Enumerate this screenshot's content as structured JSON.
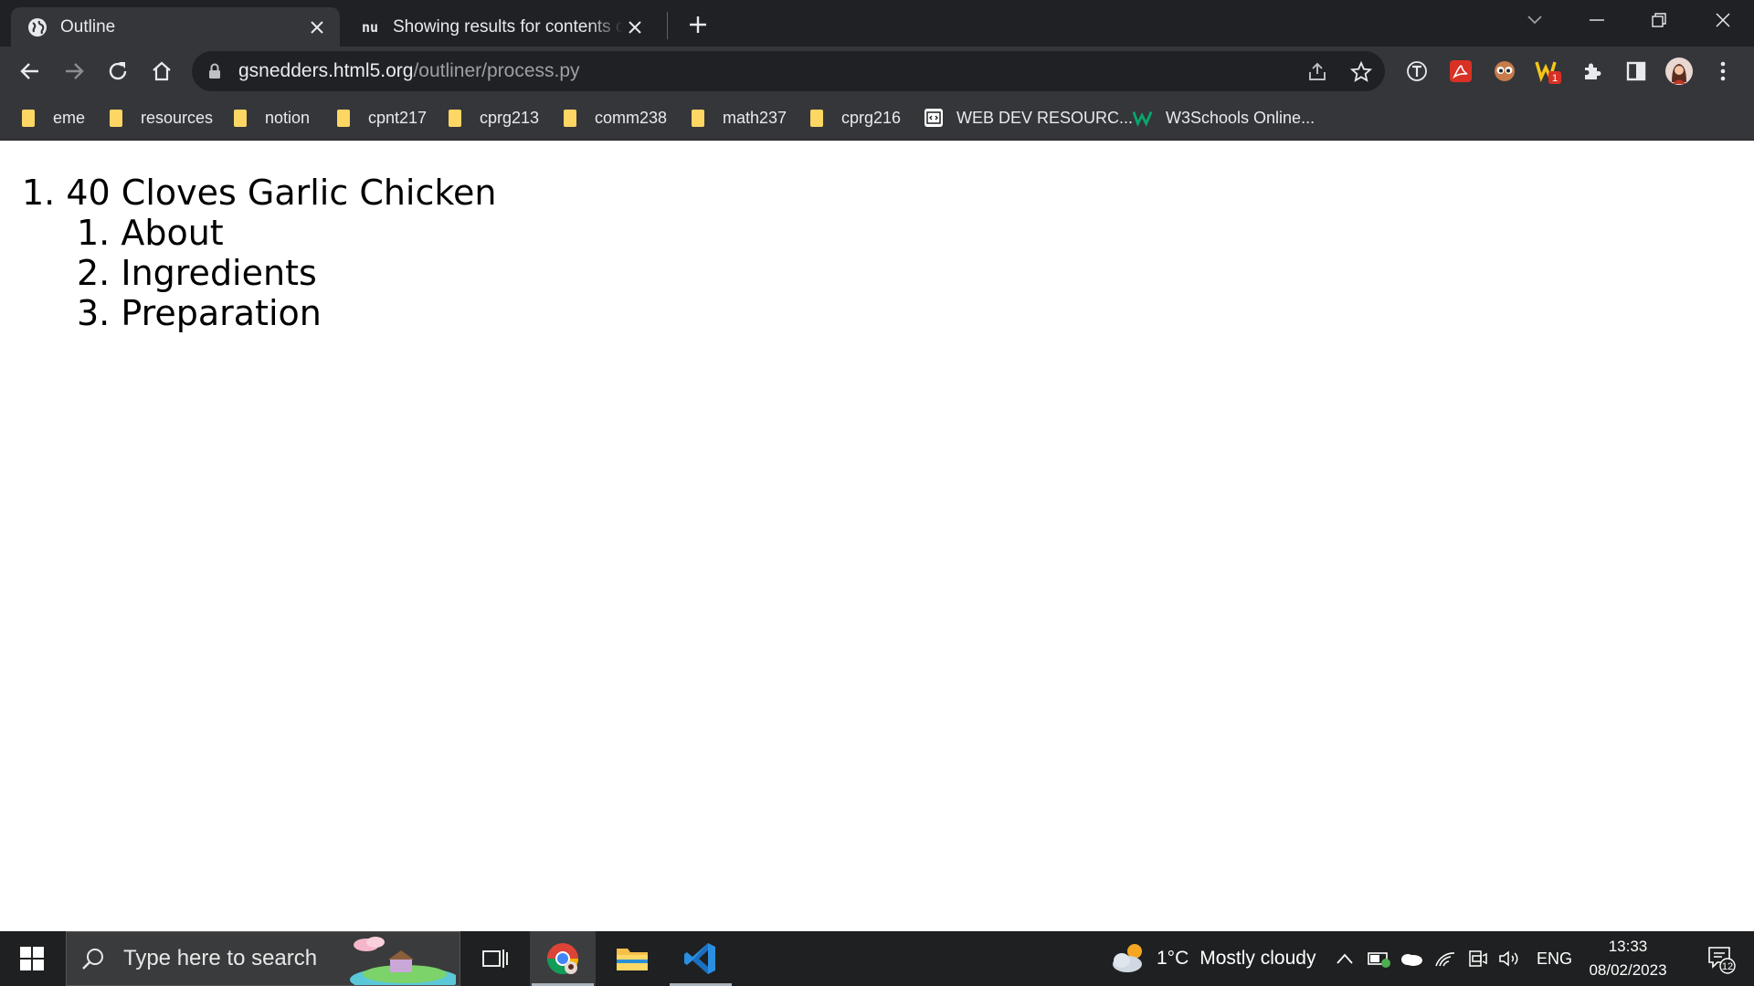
{
  "browser": {
    "tabs": [
      {
        "title": "Outline",
        "favicon": "globe-icon",
        "active": true
      },
      {
        "title": "Showing results for contents of text",
        "favicon": "nu-icon",
        "favicon_text": "nu",
        "active": false
      }
    ],
    "address": {
      "host": "gsnedders.html5.org",
      "path": "/outliner/process.py"
    },
    "bookmarks": [
      {
        "label": "eme",
        "icon": "folder-icon"
      },
      {
        "label": "resources",
        "icon": "folder-icon"
      },
      {
        "label": "notion",
        "icon": "folder-icon"
      },
      {
        "label": "cpnt217",
        "icon": "folder-icon"
      },
      {
        "label": "cprg213",
        "icon": "folder-icon"
      },
      {
        "label": "comm238",
        "icon": "folder-icon"
      },
      {
        "label": "math237",
        "icon": "folder-icon"
      },
      {
        "label": "cprg216",
        "icon": "folder-icon"
      },
      {
        "label": "WEB DEV RESOURC...",
        "icon": "webdev-icon"
      },
      {
        "label": "W3Schools Online...",
        "icon": "w3schools-icon"
      }
    ],
    "extension_badge": "1"
  },
  "page": {
    "outline": [
      {
        "number": "1.",
        "text": "40 Cloves Garlic Chicken",
        "children": [
          {
            "number": "1.",
            "text": "About"
          },
          {
            "number": "2.",
            "text": "Ingredients"
          },
          {
            "number": "3.",
            "text": "Preparation"
          }
        ]
      }
    ]
  },
  "taskbar": {
    "search_placeholder": "Type here to search",
    "weather": {
      "temp": "1°C",
      "condition": "Mostly cloudy"
    },
    "language": "ENG",
    "time": "13:33",
    "date": "08/02/2023",
    "notifications": "12"
  },
  "colors": {
    "chrome_dark": "#202124",
    "chrome_toolbar": "#35363a",
    "folder": "#fdd663",
    "vscode": "#2a8fe0"
  }
}
